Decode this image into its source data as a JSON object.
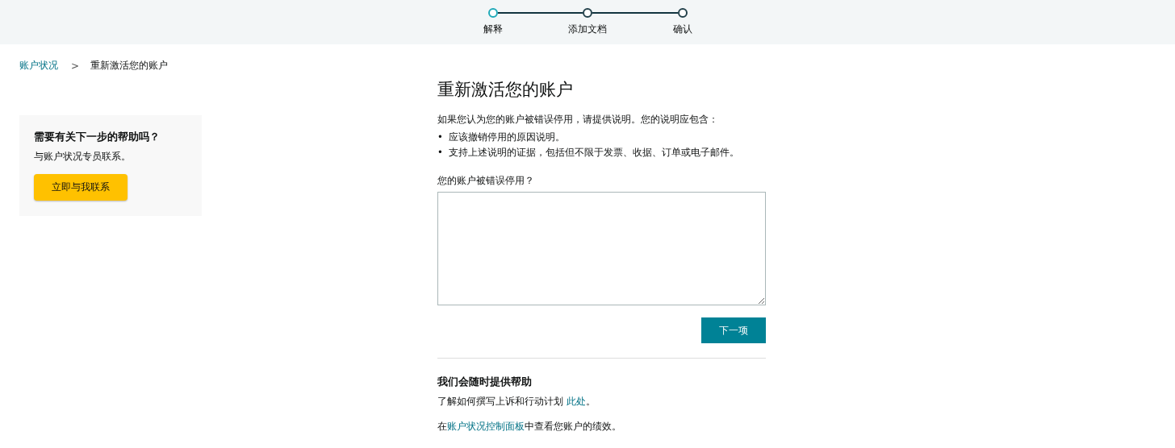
{
  "stepper": [
    {
      "label": "解释",
      "selected": true
    },
    {
      "label": "添加文档",
      "selected": false
    },
    {
      "label": "确认",
      "selected": false
    }
  ],
  "breadcrumb": {
    "link": "账户状况",
    "separator": ">",
    "current": "重新激活您的账户"
  },
  "help_card": {
    "title": "需要有关下一步的帮助吗？",
    "text": "与账户状况专员联系。",
    "button": "立即与我联系"
  },
  "main": {
    "title": "重新激活您的账户",
    "intro": "如果您认为您的账户被错误停用，请提供说明。您的说明应包含：",
    "bullets": [
      {
        "marker": "•",
        "text": "应该撤销停用的原因说明。"
      },
      {
        "marker": "•",
        "text": "支持上述说明的证据，包括但不限于发票、收据、订单或电子邮件。"
      }
    ],
    "field_label": "您的账户被错误停用？",
    "next_button": "下一项"
  },
  "help_section": {
    "title": "我们会随时提供帮助",
    "lines": [
      {
        "before": "了解如何撰写上诉和行动计划 ",
        "link": "此处",
        "after": "。"
      },
      {
        "before": "在",
        "link": "账户状况控制面板",
        "after": "中查看您账户的绩效。"
      }
    ]
  }
}
